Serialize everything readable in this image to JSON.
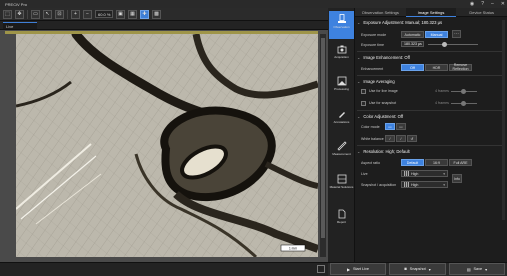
{
  "app": {
    "title": "PRECiV Pro"
  },
  "toolbar": {
    "zoom": "60.0 %"
  },
  "image_tab": {
    "label": "Live"
  },
  "scale_bar": "1 mm",
  "nav": [
    {
      "label": "Observation",
      "icon": "observation-icon"
    },
    {
      "label": "Acquisition",
      "icon": "acquisition-icon"
    },
    {
      "label": "Processing",
      "icon": "processing-icon"
    },
    {
      "label": "Annotations",
      "icon": "annotations-icon"
    },
    {
      "label": "Measurement",
      "icon": "measurement-icon"
    },
    {
      "label": "Material Solutions",
      "icon": "material-solutions-icon"
    },
    {
      "label": "Report",
      "icon": "report-icon"
    }
  ],
  "panel": {
    "tabs": [
      "Observation Settings",
      "Image Settings",
      "Device Status"
    ],
    "exposure": {
      "header": "Exposure Adjustment: Manual; 180.323 µs",
      "mode_label": "Exposure mode",
      "mode_options": [
        "Automatic",
        "Manual"
      ],
      "time_label": "Exposure time",
      "time_value": "180.323 µs"
    },
    "enhancement": {
      "header": "Image Enhancement: Off",
      "label": "Enhancement",
      "options": [
        "Off",
        "HDR",
        "Remove Reflection"
      ]
    },
    "averaging": {
      "header": "Image Averaging",
      "live_label": "Use for live image",
      "live_value": "4 frames",
      "snap_label": "Use for snapshot",
      "snap_value": "4 frames"
    },
    "color": {
      "header": "Color Adjustment: Off",
      "mode_label": "Color mode",
      "wb_label": "White balance"
    },
    "resolution": {
      "header": "Resolution: High; Default",
      "aspect_label": "Aspect ratio",
      "aspect_options": [
        "Default",
        "16:9",
        "Full ARE"
      ],
      "live_label": "Live",
      "live_value": "High",
      "snap_label": "Snapshot / acquisition",
      "snap_value": "High",
      "info_btn": "Info"
    }
  },
  "actions": {
    "start_live": "Start Live",
    "snapshot": "Snapshot",
    "save": "Save"
  },
  "colors": {
    "accent": "#3e82df",
    "ruler": "#d8c84a"
  }
}
